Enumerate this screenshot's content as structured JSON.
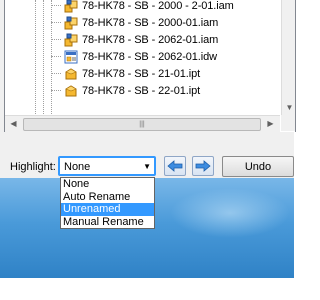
{
  "tree": {
    "items": [
      {
        "label": "78-HK78 - SB - 2000 - 2-01.iam",
        "icon": "assembly-icon"
      },
      {
        "label": "78-HK78 - SB - 2000-01.iam",
        "icon": "assembly-icon"
      },
      {
        "label": "78-HK78 - SB - 2062-01.iam",
        "icon": "assembly-icon"
      },
      {
        "label": "78-HK78 - SB - 2062-01.idw",
        "icon": "drawing-icon"
      },
      {
        "label": "78-HK78 - SB - 21-01.ipt",
        "icon": "part-icon"
      },
      {
        "label": "78-HK78 - SB - 22-01.ipt",
        "icon": "part-icon"
      }
    ]
  },
  "controls": {
    "highlight_label": "Highlight:",
    "highlight_value": "None",
    "undo_label": "Undo"
  },
  "dropdown": {
    "options": [
      "None",
      "Auto Rename",
      "Unrenamed",
      "Manual Rename"
    ],
    "selected_index": 2
  },
  "colors": {
    "selection": "#3399ff",
    "dialog_bg": "#f0f0f0",
    "desktop": "#4a9ad9"
  }
}
